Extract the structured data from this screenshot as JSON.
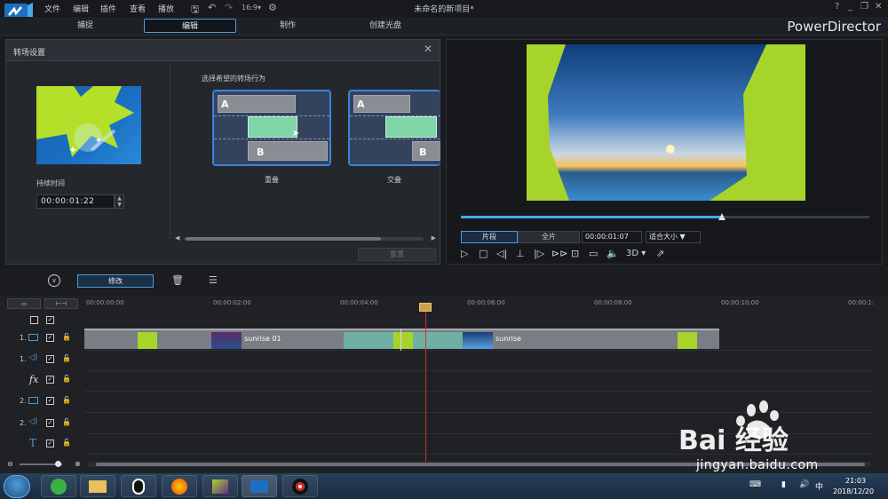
{
  "menu": {
    "file": "文件",
    "edit": "编辑",
    "plugin": "插件",
    "view": "查看",
    "play": "播放"
  },
  "window": {
    "title": "未命名的新项目*",
    "help": "?",
    "minimize": "_",
    "restore": "❐",
    "close": "✕"
  },
  "modes": {
    "capture": "捕捉",
    "edit": "编辑",
    "produce": "制作",
    "disc": "创建光盘"
  },
  "brand": "PowerDirector",
  "panel": {
    "title": "转场设置",
    "close": "✕",
    "duration_label": "持续时间",
    "duration_value": "00:00:01:22",
    "choose_label": "选择希望的转场行为",
    "options": [
      {
        "label": "重叠",
        "a": "A",
        "b": "B"
      },
      {
        "label": "交叠",
        "a": "A",
        "b": "B"
      }
    ],
    "reset": "重置"
  },
  "preview": {
    "seg_clip": "片段",
    "seg_full": "全片",
    "time": "00:00:01:07",
    "fit": "适合大小",
    "fit_arrow": "▼",
    "threed": "3D",
    "scrub_progress": 0.64
  },
  "timeline": {
    "modify": "修改",
    "ticks": [
      "00:00:00:00",
      "00:00:02:00",
      "00:00:04:00",
      "00:00:06:00",
      "00:00:08:00",
      "00:00:10:00",
      "00:00:1:"
    ],
    "tracks": [
      {
        "num": "1.",
        "kind": "video-icon"
      },
      {
        "num": "1.",
        "kind": "audio-icon"
      },
      {
        "num": "",
        "kind": "fx-icon",
        "label": "fx"
      },
      {
        "num": "2.",
        "kind": "video-icon"
      },
      {
        "num": "2.",
        "kind": "audio-icon"
      },
      {
        "num": "",
        "kind": "title-icon",
        "label": "T"
      }
    ],
    "clips": [
      {
        "name": "sunrise 01"
      },
      {
        "name": "sunrise"
      }
    ]
  },
  "taskbar": {
    "time": "21:03",
    "date": "2018/12/20"
  },
  "watermark": {
    "text": "jingyan.baidu.com",
    "logo": "Bai 经验"
  }
}
